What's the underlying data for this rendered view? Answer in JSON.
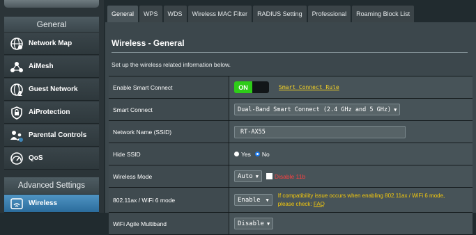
{
  "sidebar": {
    "general_header": "General",
    "items": [
      {
        "label": "Network Map",
        "icon": "network-map-icon"
      },
      {
        "label": "AiMesh",
        "icon": "aimesh-icon"
      },
      {
        "label": "Guest Network",
        "icon": "guest-network-icon"
      },
      {
        "label": "AiProtection",
        "icon": "shield-icon"
      },
      {
        "label": "Parental Controls",
        "icon": "parental-controls-icon"
      },
      {
        "label": "QoS",
        "icon": "qos-gauge-icon"
      }
    ],
    "advanced_header": "Advanced Settings",
    "advanced_items": [
      {
        "label": "Wireless",
        "icon": "wifi-icon",
        "active": true
      }
    ]
  },
  "tabs": [
    {
      "label": "General",
      "active": true
    },
    {
      "label": "WPS"
    },
    {
      "label": "WDS"
    },
    {
      "label": "Wireless MAC Filter"
    },
    {
      "label": "RADIUS Setting"
    },
    {
      "label": "Professional"
    },
    {
      "label": "Roaming Block List"
    }
  ],
  "main": {
    "title": "Wireless - General",
    "description": "Set up the wireless related information below.",
    "rows": {
      "smart_connect_enable": {
        "label": "Enable Smart Connect",
        "toggle": "ON",
        "link": "Smart Connect Rule"
      },
      "smart_connect": {
        "label": "Smart Connect",
        "value": "Dual-Band Smart Connect (2.4 GHz and 5 GHz)"
      },
      "ssid": {
        "label": "Network Name (SSID)",
        "value": "RT-AX55"
      },
      "hide_ssid": {
        "label": "Hide SSID",
        "yes": "Yes",
        "no": "No",
        "selected": "No"
      },
      "wireless_mode": {
        "label": "Wireless Mode",
        "value": "Auto",
        "checkbox_label": "Disable 11b"
      },
      "ax_mode": {
        "label": "802.11ax / WiFi 6 mode",
        "value": "Enable",
        "warning_line1": "If compatibility issue occurs when enabling 802.11ax / WiFi 6 mode,",
        "warning_line2": "please check: ",
        "faq": "FAQ"
      },
      "agile_multiband": {
        "label": "WiFi Agile Multiband",
        "value": "Disable"
      }
    }
  },
  "colors": {
    "toggle_on": "#2ecc18",
    "link": "#f6d326",
    "warning": "#f5c90c",
    "red": "#ff4040",
    "active_nav": "#3f86b8"
  }
}
